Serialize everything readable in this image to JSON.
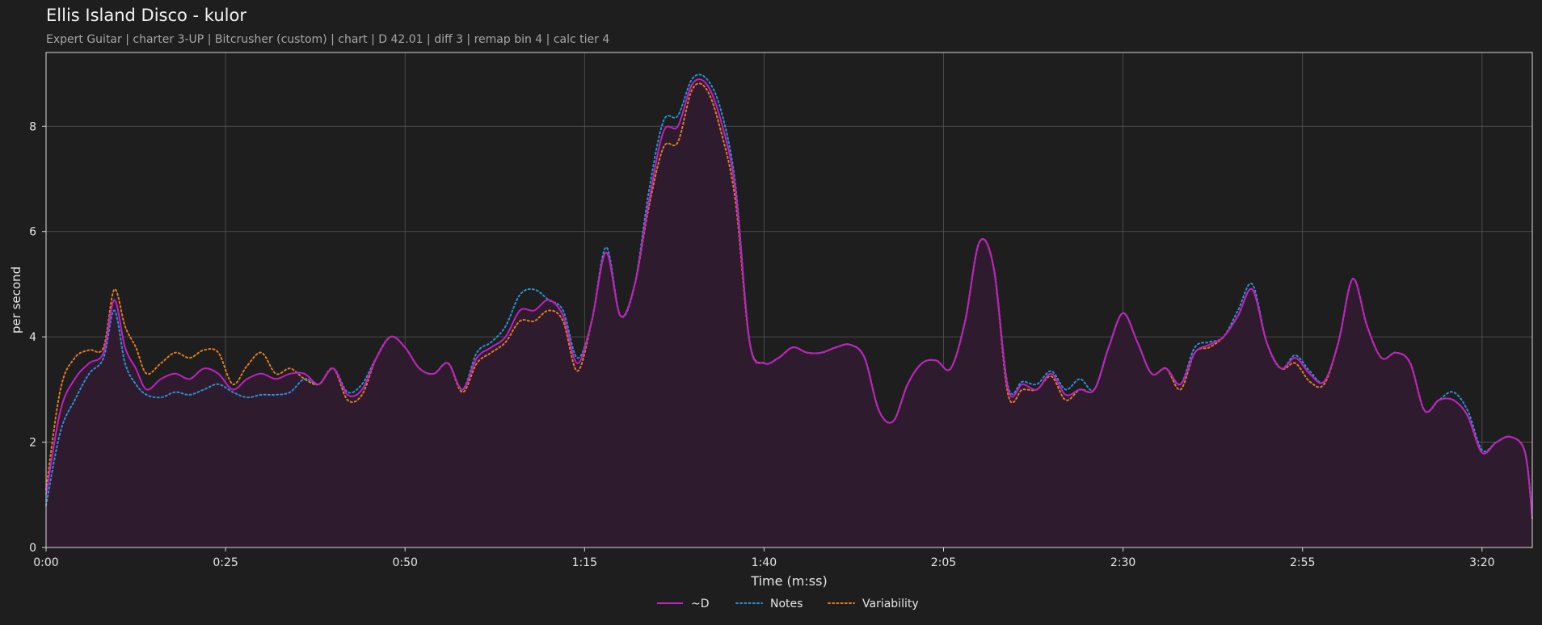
{
  "header": {
    "title": "Ellis Island Disco - kulor",
    "subtitle": "Expert Guitar  |  charter 3-UP  |  Bitcrusher (custom)  |  chart  |  D 42.01  |  diff 3  |  remap bin 4  |  calc tier 4"
  },
  "chart_data": {
    "type": "line",
    "xlabel": "Time (m:ss)",
    "ylabel": "per second",
    "xlim": [
      0,
      207
    ],
    "ylim": [
      0,
      9.4
    ],
    "x_ticks": [
      0,
      25,
      50,
      75,
      100,
      125,
      150,
      175,
      200
    ],
    "x_tick_labels": [
      "0:00",
      "0:25",
      "0:50",
      "1:15",
      "1:40",
      "2:05",
      "2:30",
      "2:55",
      "3:20"
    ],
    "y_ticks": [
      0,
      2,
      4,
      6,
      8
    ],
    "y_tick_labels": [
      "0",
      "2",
      "4",
      "6",
      "8"
    ],
    "grid": true,
    "legend_placement": "bottom-center",
    "x": [
      0,
      2,
      4,
      6,
      8,
      9.5,
      11,
      12.5,
      14,
      16,
      18,
      20,
      22,
      24,
      26,
      28,
      30,
      32,
      34,
      36,
      38,
      40,
      42,
      44,
      46,
      48,
      50,
      52,
      54,
      56,
      58,
      60,
      62,
      64,
      66,
      68,
      70,
      72,
      74,
      76,
      78,
      80,
      82,
      84,
      86,
      88,
      90,
      92,
      94,
      96,
      98,
      100,
      102,
      104,
      106,
      108,
      110,
      112,
      114,
      116,
      118,
      120,
      122,
      124,
      126,
      128,
      130,
      132,
      134,
      136,
      138,
      140,
      142,
      144,
      146,
      148,
      150,
      152,
      154,
      156,
      158,
      160,
      162,
      164,
      166,
      168,
      170,
      172,
      174,
      176,
      178,
      180,
      182,
      184,
      186,
      188,
      190,
      192,
      194,
      196,
      198,
      200,
      202,
      204,
      206,
      207
    ],
    "series": [
      {
        "name": "~D",
        "color": "#c020c0",
        "style": "solid",
        "fill": "#2e1c2e",
        "values": [
          1.0,
          2.6,
          3.2,
          3.5,
          3.7,
          4.7,
          3.8,
          3.4,
          3.0,
          3.2,
          3.3,
          3.2,
          3.4,
          3.3,
          3.0,
          3.2,
          3.3,
          3.2,
          3.3,
          3.3,
          3.1,
          3.4,
          2.9,
          3.0,
          3.6,
          4.0,
          3.8,
          3.4,
          3.3,
          3.5,
          3.0,
          3.6,
          3.8,
          4.0,
          4.5,
          4.5,
          4.7,
          4.4,
          3.5,
          4.3,
          5.6,
          4.4,
          5.0,
          6.6,
          7.9,
          8.0,
          8.8,
          8.8,
          8.1,
          6.8,
          3.9,
          3.5,
          3.6,
          3.8,
          3.7,
          3.7,
          3.8,
          3.85,
          3.6,
          2.6,
          2.4,
          3.1,
          3.5,
          3.55,
          3.4,
          4.3,
          5.8,
          5.3,
          3.0,
          3.1,
          3.0,
          3.3,
          2.9,
          3.0,
          3.0,
          3.8,
          4.45,
          3.9,
          3.3,
          3.4,
          3.1,
          3.7,
          3.85,
          4.0,
          4.4,
          4.9,
          3.9,
          3.4,
          3.6,
          3.3,
          3.15,
          3.9,
          5.1,
          4.2,
          3.6,
          3.7,
          3.5,
          2.6,
          2.8,
          2.8,
          2.5,
          1.8,
          2.0,
          2.1,
          1.8,
          0.55
        ]
      },
      {
        "name": "Notes",
        "color": "#2a8fd6",
        "style": "dotted",
        "values": [
          0.8,
          2.2,
          2.8,
          3.3,
          3.6,
          4.5,
          3.5,
          3.1,
          2.9,
          2.85,
          2.95,
          2.9,
          3.0,
          3.1,
          2.95,
          2.85,
          2.9,
          2.9,
          2.95,
          3.2,
          3.1,
          3.4,
          2.95,
          3.1,
          3.6,
          4.0,
          3.8,
          3.4,
          3.3,
          3.5,
          3.0,
          3.7,
          3.9,
          4.2,
          4.8,
          4.9,
          4.7,
          4.5,
          3.6,
          4.3,
          5.7,
          4.4,
          5.0,
          6.8,
          8.1,
          8.2,
          8.9,
          8.9,
          8.3,
          6.9,
          3.9,
          3.5,
          3.6,
          3.8,
          3.7,
          3.7,
          3.8,
          3.85,
          3.6,
          2.6,
          2.4,
          3.1,
          3.5,
          3.55,
          3.4,
          4.3,
          5.8,
          5.3,
          3.05,
          3.15,
          3.1,
          3.35,
          3.0,
          3.2,
          3.0,
          3.8,
          4.45,
          3.9,
          3.3,
          3.4,
          3.1,
          3.8,
          3.9,
          4.0,
          4.5,
          5.0,
          3.9,
          3.4,
          3.65,
          3.35,
          3.15,
          3.9,
          5.1,
          4.2,
          3.6,
          3.7,
          3.5,
          2.6,
          2.8,
          2.95,
          2.6,
          1.85,
          2.0,
          2.1,
          1.8,
          0.55
        ]
      },
      {
        "name": "Variability",
        "color": "#e07b22",
        "style": "dotted",
        "values": [
          1.1,
          3.0,
          3.6,
          3.75,
          3.8,
          4.9,
          4.2,
          3.8,
          3.3,
          3.5,
          3.7,
          3.6,
          3.75,
          3.7,
          3.1,
          3.45,
          3.7,
          3.3,
          3.4,
          3.2,
          3.1,
          3.4,
          2.8,
          2.9,
          3.6,
          4.0,
          3.8,
          3.4,
          3.3,
          3.5,
          2.95,
          3.5,
          3.7,
          3.9,
          4.3,
          4.3,
          4.5,
          4.3,
          3.35,
          4.3,
          5.6,
          4.4,
          5.0,
          6.5,
          7.6,
          7.7,
          8.7,
          8.7,
          7.9,
          6.6,
          3.9,
          3.5,
          3.6,
          3.8,
          3.7,
          3.7,
          3.8,
          3.85,
          3.6,
          2.6,
          2.4,
          3.1,
          3.5,
          3.55,
          3.4,
          4.3,
          5.8,
          5.3,
          2.9,
          3.0,
          3.0,
          3.25,
          2.8,
          3.0,
          3.0,
          3.8,
          4.45,
          3.9,
          3.3,
          3.4,
          3.0,
          3.7,
          3.8,
          4.0,
          4.4,
          4.9,
          3.9,
          3.4,
          3.5,
          3.15,
          3.1,
          3.9,
          5.1,
          4.2,
          3.6,
          3.7,
          3.5,
          2.6,
          2.8,
          2.8,
          2.5,
          1.8,
          2.0,
          2.1,
          1.8,
          0.55
        ]
      }
    ]
  },
  "legend": {
    "items": [
      {
        "label": "~D",
        "color": "#c020c0",
        "style": "solid"
      },
      {
        "label": "Notes",
        "color": "#2a8fd6",
        "style": "dotted"
      },
      {
        "label": "Variability",
        "color": "#e07b22",
        "style": "dotted"
      }
    ]
  }
}
